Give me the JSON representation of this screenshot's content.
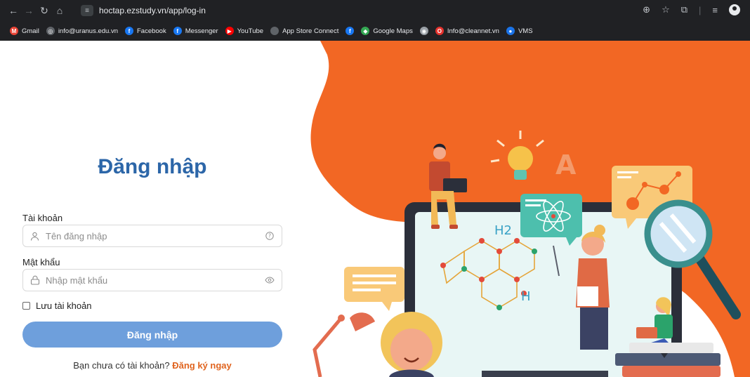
{
  "browser": {
    "url": "hoctap.ezstudy.vn/app/log-in",
    "bookmarks": [
      {
        "label": "Gmail",
        "icon": "gmail-icon",
        "color": "#ea4335"
      },
      {
        "label": "info@uranus.edu.vn",
        "icon": "site-icon",
        "color": "#5f6368"
      },
      {
        "label": "Facebook",
        "icon": "facebook-icon",
        "color": "#1877f2"
      },
      {
        "label": "Messenger",
        "icon": "facebook-icon",
        "color": "#1877f2"
      },
      {
        "label": "YouTube",
        "icon": "youtube-icon",
        "color": "#ff0000"
      },
      {
        "label": "App Store Connect",
        "icon": "apple-icon",
        "color": "#5f6368"
      },
      {
        "label": "",
        "icon": "facebook-icon",
        "color": "#1877f2"
      },
      {
        "label": "Google Maps",
        "icon": "maps-icon",
        "color": "#34a853"
      },
      {
        "label": "",
        "icon": "globe-icon",
        "color": "#9aa0a6"
      },
      {
        "label": "Info@cleannet.vn",
        "icon": "opera-icon",
        "color": "#e5322d"
      },
      {
        "label": "VMS",
        "icon": "vms-icon",
        "color": "#1a73e8"
      }
    ]
  },
  "login": {
    "title": "Đăng nhập",
    "account_label": "Tài khoản",
    "account_placeholder": "Tên đăng nhập",
    "password_label": "Mật khẩu",
    "password_placeholder": "Nhập mật khẩu",
    "remember_label": "Lưu tài khoản",
    "submit_label": "Đăng nhập",
    "signup_text": "Bạn chưa có tài khoản?",
    "signup_link": "Đăng ký ngay"
  },
  "illustration": {
    "h2_label": "H2",
    "h_label": "H",
    "a_letter": "A"
  },
  "colors": {
    "brand_blue": "#2c66a8",
    "button_blue": "#6e9fdc",
    "accent_orange": "#e0641f",
    "hero_orange": "#f26724"
  }
}
